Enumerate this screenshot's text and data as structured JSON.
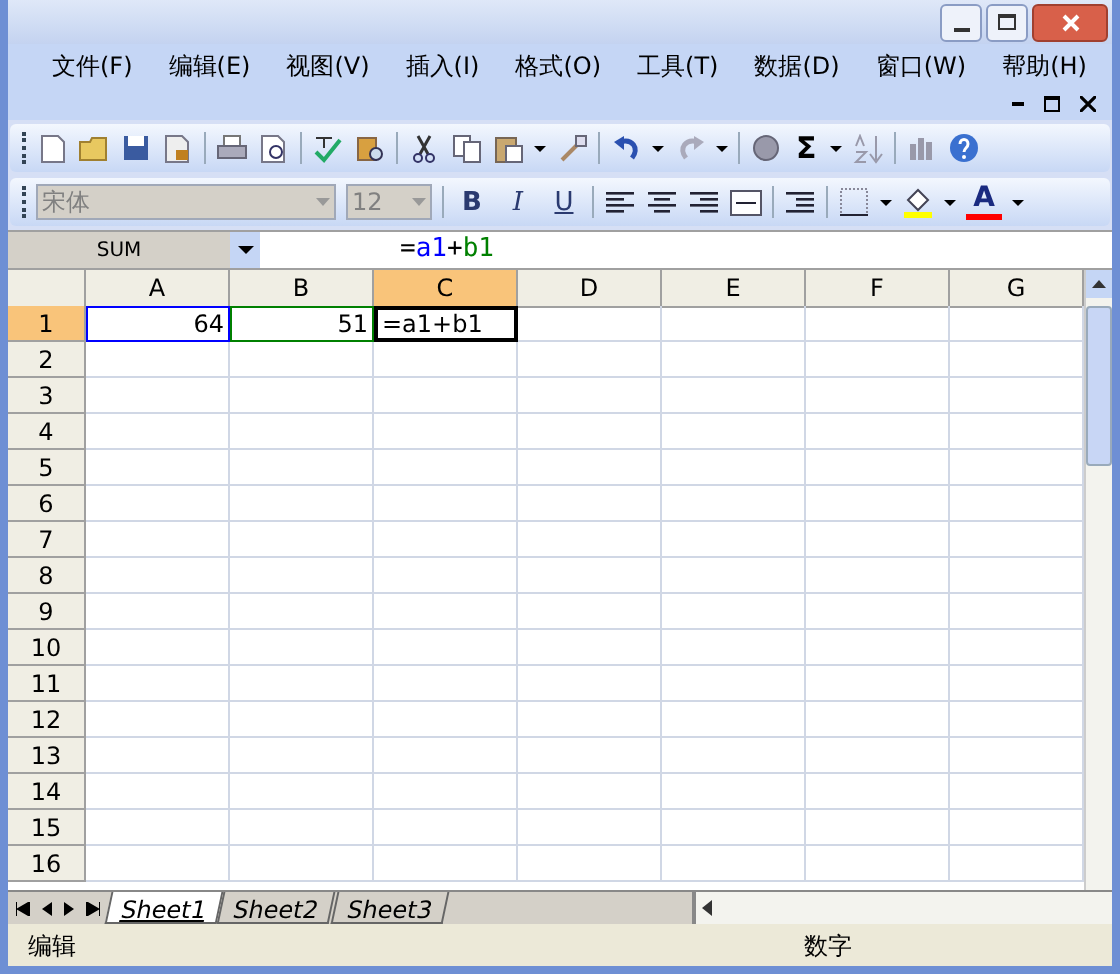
{
  "menu": [
    "文件(F)",
    "编辑(E)",
    "视图(V)",
    "插入(I)",
    "格式(O)",
    "工具(T)",
    "数据(D)",
    "窗口(W)",
    "帮助(H)"
  ],
  "standard_toolbar": {
    "autosum": "Σ"
  },
  "formatting_toolbar": {
    "font": {
      "value": "宋体",
      "disabled": true
    },
    "size": {
      "value": "12",
      "disabled": true
    },
    "bold": "B",
    "italic": "I",
    "underline": "U",
    "font_color": "A"
  },
  "formula_bar": {
    "name_box": "SUM",
    "formula": [
      {
        "text": "=",
        "color": "#000000"
      },
      {
        "text": "a1",
        "color": "#0000ff"
      },
      {
        "text": "+",
        "color": "#000000"
      },
      {
        "text": "b1",
        "color": "#008000"
      }
    ]
  },
  "sheet": {
    "columns": [
      {
        "label": "A",
        "selected": false
      },
      {
        "label": "B",
        "selected": false
      },
      {
        "label": "C",
        "selected": true
      },
      {
        "label": "D",
        "selected": false
      },
      {
        "label": "E",
        "selected": false
      },
      {
        "label": "F",
        "selected": false
      },
      {
        "label": "G",
        "selected": false
      }
    ],
    "rows": [
      {
        "label": "1",
        "selected": true,
        "cells": [
          {
            "text": "64",
            "color": "#0000ff",
            "editing": false
          },
          {
            "text": "51",
            "color": "#008000",
            "editing": false
          },
          {
            "text": "=a1+b1",
            "color": "#000000",
            "editing": true
          }
        ]
      },
      {
        "label": "2",
        "selected": false
      },
      {
        "label": "3",
        "selected": false
      },
      {
        "label": "4",
        "selected": false
      },
      {
        "label": "5",
        "selected": false
      },
      {
        "label": "6",
        "selected": false
      },
      {
        "label": "7",
        "selected": false
      },
      {
        "label": "8",
        "selected": false
      },
      {
        "label": "9",
        "selected": false
      },
      {
        "label": "10",
        "selected": false
      },
      {
        "label": "11",
        "selected": false
      },
      {
        "label": "12",
        "selected": false
      },
      {
        "label": "13",
        "selected": false
      },
      {
        "label": "14",
        "selected": false
      },
      {
        "label": "15",
        "selected": false
      },
      {
        "label": "16",
        "selected": false
      }
    ]
  },
  "sheet_tabs": [
    {
      "label": "Sheet1",
      "selected": true
    },
    {
      "label": "Sheet2",
      "selected": false
    },
    {
      "label": "Sheet3",
      "selected": false
    }
  ],
  "status_bar": {
    "mode": "编辑",
    "indicator": "数字"
  }
}
